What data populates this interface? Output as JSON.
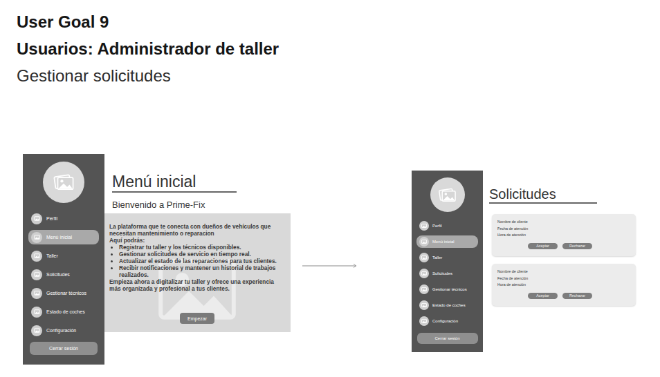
{
  "slide": {
    "goal": "User Goal 9",
    "users": "Usuarios: Administrador de taller",
    "task": "Gestionar solicitudes"
  },
  "home": {
    "sidebar": {
      "items": [
        {
          "label": "Perfil",
          "selected": false
        },
        {
          "label": "Menú inicial",
          "selected": true
        },
        {
          "label": "Taller",
          "selected": false
        },
        {
          "label": "Solicitudes",
          "selected": false
        },
        {
          "label": "Gestionar técnicos",
          "selected": false
        },
        {
          "label": "Estado de coches",
          "selected": false
        },
        {
          "label": "Configuración",
          "selected": false
        }
      ],
      "logout": "Cerrar sesión"
    },
    "heading": "Menú inicial",
    "subtitle": "Bienvenido a Prime-Fix",
    "intro": "La plataforma que te conecta con dueños de vehículos que necesitan mantenimiento o reparacion",
    "lead": "Aquí podrás:",
    "bullets": [
      "Registrar tu taller y los técnicos disponibles.",
      "Gestionar solicitudes de servicio en tiempo real.",
      "Actualizar el estado de las reparaciones para tus clientes.",
      "Recibir notificaciones y mantener un historial de trabajos realizados."
    ],
    "closing": "Empieza ahora a digitalizar tu taller y ofrece una experiencia más organizada y profesional a tus clientes.",
    "button": "Empezar"
  },
  "requests": {
    "sidebar": {
      "items": [
        {
          "label": "Perfil",
          "selected": false
        },
        {
          "label": "Menú inicial",
          "selected": true
        },
        {
          "label": "Taller",
          "selected": false
        },
        {
          "label": "Solicitudes",
          "selected": false
        },
        {
          "label": "Gestionar técnicos",
          "selected": false
        },
        {
          "label": "Estado de coches",
          "selected": false
        },
        {
          "label": "Configuración",
          "selected": false
        }
      ],
      "logout": "Cerrar sesión"
    },
    "heading": "Solicitudes",
    "cards": [
      {
        "fields": [
          "Nombre de cliente",
          "Fecha de atención",
          "Hora de atención"
        ],
        "buttons": [
          "Aceptar",
          "Rechazar"
        ]
      },
      {
        "fields": [
          "Nombre de cliente",
          "Fecha de atención",
          "Hora de atención"
        ],
        "buttons": [
          "Aceptar",
          "Rechazar"
        ]
      }
    ]
  }
}
